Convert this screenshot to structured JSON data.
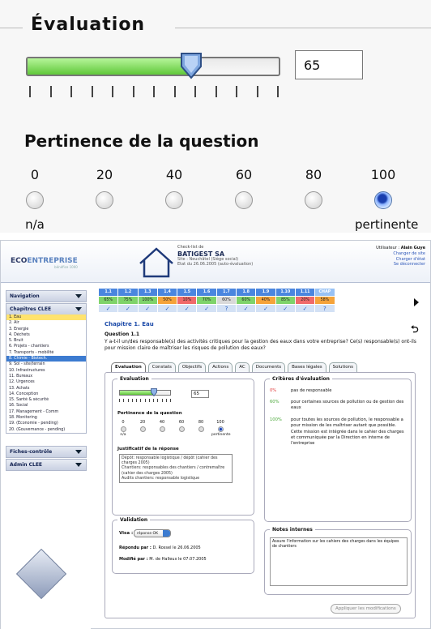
{
  "zoom": {
    "title": "Évaluation",
    "value": "65",
    "slider_fraction": 0.65,
    "question_title": "Pertinence de la question",
    "options": [
      {
        "value": "0",
        "sub": "n/a",
        "selected": false
      },
      {
        "value": "20",
        "sub": "",
        "selected": false
      },
      {
        "value": "40",
        "sub": "",
        "selected": false
      },
      {
        "value": "60",
        "sub": "",
        "selected": false
      },
      {
        "value": "80",
        "sub": "",
        "selected": false
      },
      {
        "value": "100",
        "sub": "pertinente",
        "selected": true
      }
    ]
  },
  "header": {
    "logo_bold": "ECO",
    "logo_light": "ENTREPRISE",
    "logo_small": "bénéfice 1000",
    "checklist_label": "Check-list de",
    "company": "BATIGEST SA",
    "site": "Site : Neuchâtel (Siège social)",
    "state": "Etat du 26.06.2005 (auto-évaluation)",
    "user_label": "Utilisateur :",
    "user_name": "Alain Guye",
    "links": [
      "Changer de site",
      "Charger d'état",
      "Se déconnecter"
    ]
  },
  "sidebar": {
    "navigation": "Navigation",
    "chapters_title": "Chapitres CLEE",
    "chapters": [
      "1. Eau",
      "2. Air",
      "3. Energie",
      "4. Déchets",
      "5. Bruit",
      "6. Projets - chantiers",
      "7. Transports - mobilité",
      "8. Chimie - Biotech.",
      "9. Sol - site/terrain",
      "10. Infrastructures",
      "11. Bureaux",
      "12. Urgences",
      "13. Achats",
      "14. Conception",
      "15. Santé & sécurité",
      "16. Social",
      "17. Management - Comm",
      "18. Monitoring",
      "19. (Economie - pending)",
      "20. (Gouvernance - pending)"
    ],
    "selected_index": 0,
    "highlight_index": 7,
    "fiches": "Fiches-contrôle",
    "admin": "Admin CLEE"
  },
  "grid": {
    "headers": [
      "1.1",
      "1.2",
      "1.3",
      "1.4",
      "1.5",
      "1.6",
      "1.7",
      "1.8",
      "1.9",
      "1.10",
      "1.11",
      "CHAP"
    ],
    "scores": [
      "65%",
      "75%",
      "100%",
      "50%",
      "10%",
      "70%",
      "60%",
      "60%",
      "40%",
      "85%",
      "20%",
      "58%"
    ],
    "colors": [
      "#7fd36a",
      "#7fd36a",
      "#7fd36a",
      "#f5a33a",
      "#f06a6a",
      "#7fd36a",
      "#d9d9d9",
      "#7fd36a",
      "#f5a33a",
      "#7fd36a",
      "#f06a6a",
      "#f5a33a"
    ],
    "checks": [
      "✓",
      "✓",
      "✓",
      "✓",
      "✓",
      "✓",
      "?",
      "✓",
      "✓",
      "✓",
      "✓",
      "?"
    ]
  },
  "question": {
    "chapter": "Chapitre 1. Eau",
    "number": "Question 1.1",
    "text": "Y a-t-il un/des responsable(s) des activités critiques pour la gestion des eaux dans votre entreprise? Ce(s) responsable(s) ont-ils pour mission claire de maîtriser les risques de pollution des eaux?"
  },
  "tabs": [
    "Evaluation",
    "Constats",
    "Objectifs",
    "Actions",
    "AC",
    "Documents",
    "Bases légales",
    "Solutions"
  ],
  "evaluation": {
    "legend": "Evaluation",
    "value": "65",
    "slider_fraction": 0.65,
    "question_title": "Pertinence de la question",
    "options": [
      {
        "value": "0",
        "sub": "n/a",
        "selected": false
      },
      {
        "value": "20",
        "sub": "",
        "selected": false
      },
      {
        "value": "40",
        "sub": "",
        "selected": false
      },
      {
        "value": "60",
        "sub": "",
        "selected": false
      },
      {
        "value": "80",
        "sub": "",
        "selected": false
      },
      {
        "value": "100",
        "sub": "pertinente",
        "selected": true
      }
    ],
    "justif_label": "Justificatif de la réponse",
    "justif_text": "Dépôt: responsable logistique / dépôt (cahier des charges 2005)\nChantiers: responsables des chantiers / contremaître (cahier des charges 2005)\nAudits chantiers: responsable logistique"
  },
  "validation": {
    "legend": "Validation",
    "visa_label": "Visa :",
    "visa_value": "réponse OK",
    "answered_label": "Répondu par :",
    "answered": "D. Rossel  le  26.06.2005",
    "modified_label": "Modifié par :",
    "modified": "M. de Halleux  le  07.07.2005"
  },
  "criteria": {
    "legend": "Critères d'évaluation",
    "items": [
      {
        "pct": "0%",
        "color": "#e03b3b",
        "text": "pas de responsable"
      },
      {
        "pct": "60%",
        "color": "#4aa83a",
        "text": "pour certaines sources de pollution ou de gestion des eaux"
      },
      {
        "pct": "100%",
        "color": "#4aa83a",
        "text": "pour toutes les sources de pollution, le responsable a pour mission de les maîtriser autant que possible. Cette mission est intégrée dans le cahier des charges et communiquée par la Direction en interne de l'entreprise"
      }
    ]
  },
  "notes": {
    "legend": "Notes internes",
    "text": "Assure l'information sur les cahiers des charges dans les équipes de chantiers"
  },
  "apply_label": "Appliquer les modifications",
  "colors": {
    "accent": "#4a86df",
    "chapter": "#1a49a8",
    "selected": "#ffe36e"
  }
}
